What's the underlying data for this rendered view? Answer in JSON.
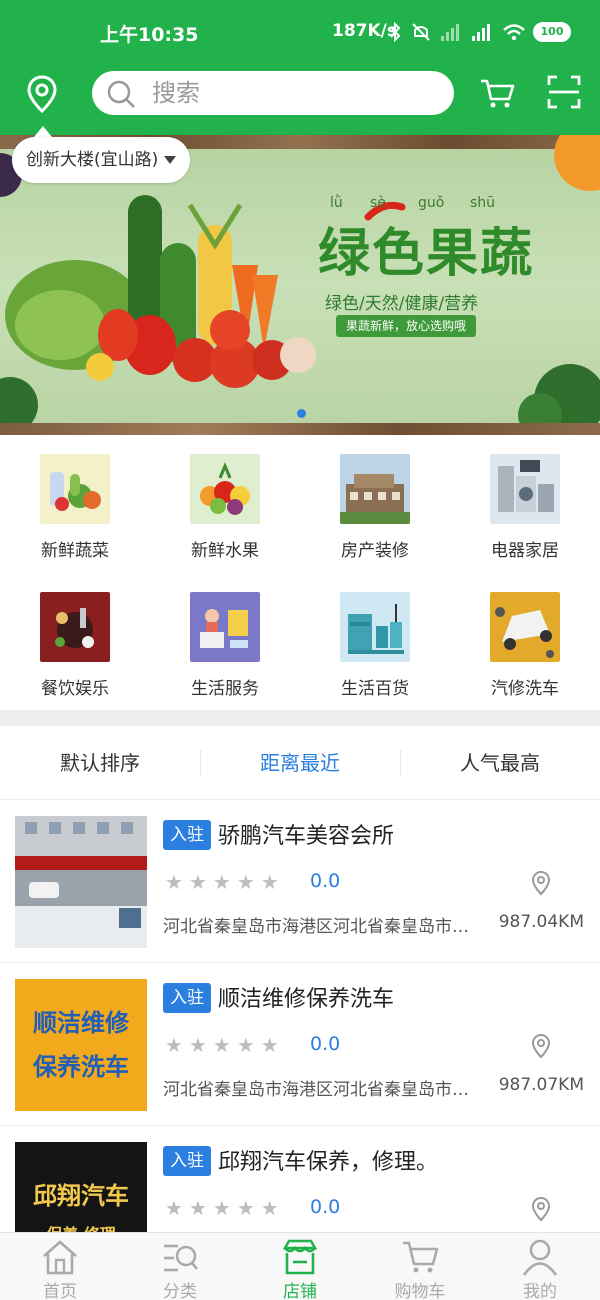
{
  "status": {
    "time": "上午10:35",
    "network": "187K/s",
    "battery": "100"
  },
  "header": {
    "search_placeholder": "搜索"
  },
  "location": {
    "address": "创新大楼(宜山路)"
  },
  "banner": {
    "title": "绿色果蔬",
    "pinyin": [
      "lǜ",
      "sè",
      "guǒ",
      "shū"
    ],
    "subtitle": "绿色/天然/健康/营养",
    "tagline": "果蔬新鲜，放心选购哦"
  },
  "categories": [
    {
      "label": "新鲜蔬菜",
      "icon": "vegetables-icon"
    },
    {
      "label": "新鲜水果",
      "icon": "fruits-icon"
    },
    {
      "label": "房产装修",
      "icon": "house-icon"
    },
    {
      "label": "电器家居",
      "icon": "appliances-icon"
    },
    {
      "label": "餐饮娱乐",
      "icon": "dining-icon"
    },
    {
      "label": "生活服务",
      "icon": "services-icon"
    },
    {
      "label": "生活百货",
      "icon": "goods-icon"
    },
    {
      "label": "汽修洗车",
      "icon": "car-wash-icon"
    }
  ],
  "sort_tabs": [
    {
      "label": "默认排序",
      "active": false
    },
    {
      "label": "距离最近",
      "active": true
    },
    {
      "label": "人气最高",
      "active": false
    }
  ],
  "shops": [
    {
      "badge": "入驻",
      "name": "骄鹏汽车美容会所",
      "score": "0.0",
      "address": "河北省秦皇岛市海港区河北省秦皇岛市海港区",
      "distance": "987.04KM",
      "rating": 0
    },
    {
      "badge": "入驻",
      "name": "顺洁维修保养洗车",
      "score": "0.0",
      "address": "河北省秦皇岛市海港区河北省秦皇岛市海港区",
      "distance": "987.07KM",
      "rating": 0,
      "sign_text": [
        "顺洁维修",
        "保养洗车"
      ]
    },
    {
      "badge": "入驻",
      "name": "邱翔汽车保养，修理。",
      "score": "0.0",
      "address": "",
      "distance": "",
      "rating": 0,
      "sign_text": [
        "邱翔汽车",
        "保养·修理"
      ]
    }
  ],
  "tabbar": [
    {
      "label": "首页",
      "icon": "home-icon",
      "active": false
    },
    {
      "label": "分类",
      "icon": "category-icon",
      "active": false
    },
    {
      "label": "店铺",
      "icon": "store-icon",
      "active": true
    },
    {
      "label": "购物车",
      "icon": "cart-icon",
      "active": false
    },
    {
      "label": "我的",
      "icon": "user-icon",
      "active": false
    }
  ],
  "colors": {
    "brand_green": "#22b24c",
    "accent_blue": "#2a7fe0"
  }
}
